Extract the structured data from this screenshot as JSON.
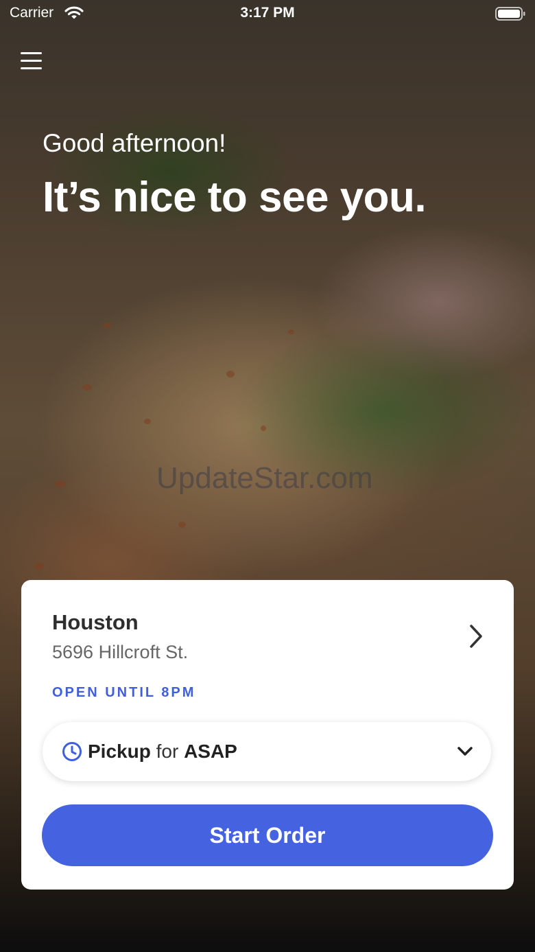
{
  "status_bar": {
    "carrier": "Carrier",
    "time": "3:17 PM"
  },
  "hero": {
    "greeting": "Good afternoon!",
    "headline": "It’s nice to see you.",
    "watermark": "UpdateStar.com"
  },
  "location": {
    "name": "Houston",
    "address": "5696 Hillcroft St.",
    "hours": "OPEN UNTIL 8PM"
  },
  "order_mode": {
    "mode": "Pickup",
    "connector": "for",
    "time": "ASAP"
  },
  "actions": {
    "start_order": "Start Order"
  },
  "colors": {
    "accent": "#4563e0",
    "card_bg": "#ffffff",
    "text_dark": "#2e2e2e"
  },
  "icons": [
    "wifi-icon",
    "battery-icon",
    "menu-icon",
    "chevron-right-icon",
    "clock-icon",
    "chevron-down-icon"
  ]
}
